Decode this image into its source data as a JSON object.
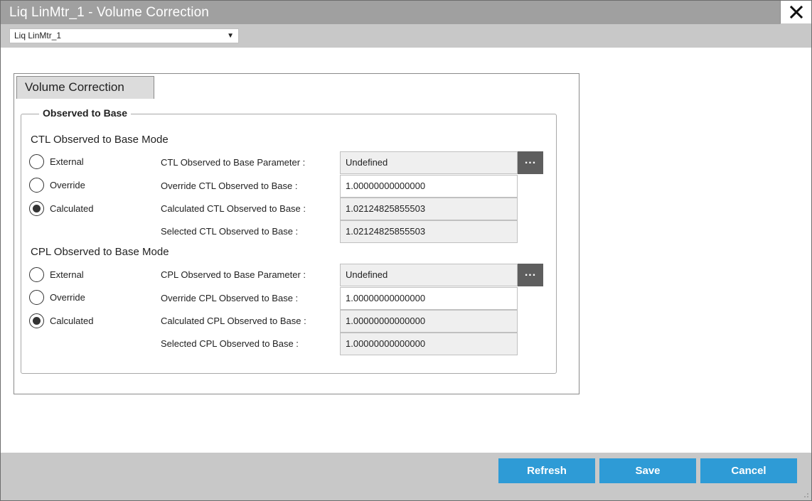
{
  "window": {
    "title": "Liq LinMtr_1 - Volume Correction",
    "close_icon": "close-icon"
  },
  "meter_select": {
    "value": "Liq LinMtr_1",
    "caret": "▼"
  },
  "tabs": [
    {
      "label": "Volume Correction",
      "active": true
    }
  ],
  "group": {
    "legend": "Observed to Base"
  },
  "ctl": {
    "mode_title": "CTL Observed to Base Mode",
    "radios": [
      {
        "label": "External",
        "checked": false
      },
      {
        "label": "Override",
        "checked": false
      },
      {
        "label": "Calculated",
        "checked": true
      }
    ],
    "fields": [
      {
        "label": "CTL Observed to Base Parameter :",
        "value": "Undefined"
      },
      {
        "label": "Override CTL Observed to Base :",
        "value": "1.00000000000000"
      },
      {
        "label": "Calculated CTL Observed to Base :",
        "value": "1.02124825855503"
      },
      {
        "label": "Selected CTL Observed to Base :",
        "value": "1.02124825855503"
      }
    ],
    "browse_label": "..."
  },
  "cpl": {
    "mode_title": "CPL Observed to Base Mode",
    "radios": [
      {
        "label": "External",
        "checked": false
      },
      {
        "label": "Override",
        "checked": false
      },
      {
        "label": "Calculated",
        "checked": true
      }
    ],
    "fields": [
      {
        "label": "CPL Observed to Base Parameter :",
        "value": "Undefined"
      },
      {
        "label": "Override CPL Observed to Base :",
        "value": "1.00000000000000"
      },
      {
        "label": "Calculated CPL Observed to Base :",
        "value": "1.00000000000000"
      },
      {
        "label": "Selected CPL Observed to Base :",
        "value": "1.00000000000000"
      }
    ],
    "browse_label": "..."
  },
  "footer": {
    "refresh_label": "Refresh",
    "save_label": "Save",
    "cancel_label": "Cancel"
  },
  "colors": {
    "titlebar": "#a0a0a0",
    "toolbar": "#c8c8c8",
    "button": "#2e9bd6",
    "browse": "#5e5e5e",
    "readonly_field": "#efefef"
  }
}
